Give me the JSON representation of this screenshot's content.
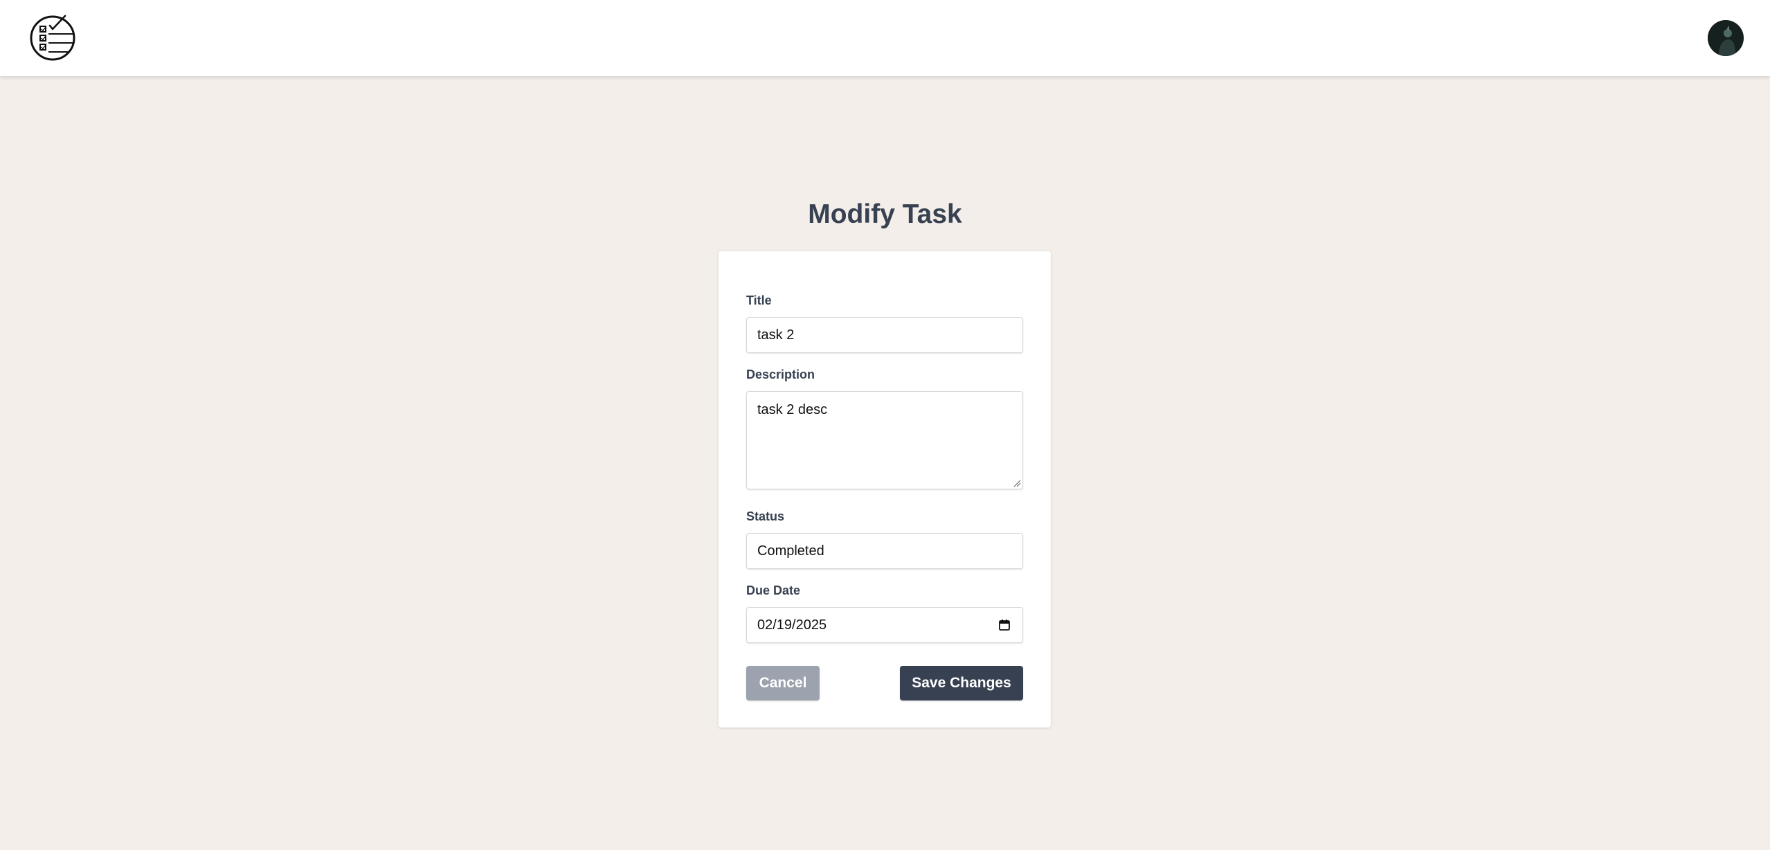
{
  "header": {
    "logo_icon": "task-checklist-logo-icon",
    "avatar_icon": "user-avatar"
  },
  "page": {
    "title": "Modify Task"
  },
  "form": {
    "title_label": "Title",
    "title_value": "task 2",
    "description_label": "Description",
    "description_value": "task 2 desc",
    "status_label": "Status",
    "status_value": "Completed",
    "due_date_label": "Due Date",
    "due_date_value": "02/19/2025",
    "due_date_icon": "calendar-icon",
    "cancel_label": "Cancel",
    "save_label": "Save Changes"
  },
  "colors": {
    "background": "#f3eeea",
    "primary_button": "#374151",
    "cancel_button": "#9ca3af",
    "heading_text": "#374151"
  }
}
